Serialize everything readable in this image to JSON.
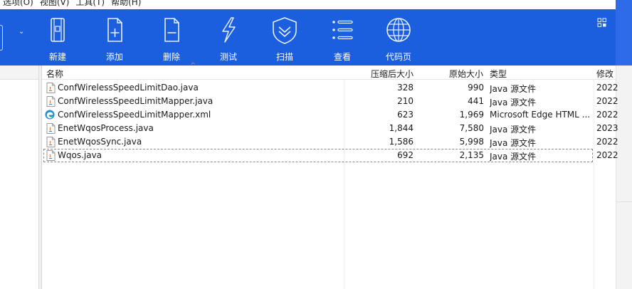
{
  "menu": {
    "items": [
      "选项(O)",
      "视图(V)",
      "工具(T)",
      "帮助(H)"
    ]
  },
  "toolbar": {
    "buttons": [
      {
        "label": "新建",
        "icon": "new-archive-icon"
      },
      {
        "label": "添加",
        "icon": "add-icon"
      },
      {
        "label": "删除",
        "icon": "delete-icon"
      },
      {
        "label": "测试",
        "icon": "test-icon"
      },
      {
        "label": "扫描",
        "icon": "scan-icon"
      },
      {
        "label": "查看",
        "icon": "view-icon"
      },
      {
        "label": "代码页",
        "icon": "codepage-icon"
      }
    ],
    "dropdown_glyph": "⌄"
  },
  "columns": {
    "name": "名称",
    "packed": "压缩后大小",
    "original": "原始大小",
    "type": "类型",
    "modified": "修改",
    "sort_glyph": "^"
  },
  "files": [
    {
      "name": "ConfWirelessSpeedLimitDao.java",
      "packed": "328",
      "original": "990",
      "type": "Java 源文件",
      "modified": "2022",
      "icon": "java-file-icon"
    },
    {
      "name": "ConfWirelessSpeedLimitMapper.java",
      "packed": "210",
      "original": "441",
      "type": "Java 源文件",
      "modified": "2022",
      "icon": "java-file-icon"
    },
    {
      "name": "ConfWirelessSpeedLimitMapper.xml",
      "packed": "623",
      "original": "1,969",
      "type": "Microsoft Edge HTML ...",
      "modified": "2022",
      "icon": "edge-icon"
    },
    {
      "name": "EnetWqosProcess.java",
      "packed": "1,844",
      "original": "7,580",
      "type": "Java 源文件",
      "modified": "2023",
      "icon": "java-file-icon"
    },
    {
      "name": "EnetWqosSync.java",
      "packed": "1,586",
      "original": "5,998",
      "type": "Java 源文件",
      "modified": "2022",
      "icon": "java-file-icon"
    },
    {
      "name": "Wqos.java",
      "packed": "692",
      "original": "2,135",
      "type": "Java 源文件",
      "modified": "2022",
      "icon": "java-file-icon"
    }
  ],
  "colors": {
    "toolbar_bg": "#1b5fdf",
    "accent": "#2d6be8"
  }
}
